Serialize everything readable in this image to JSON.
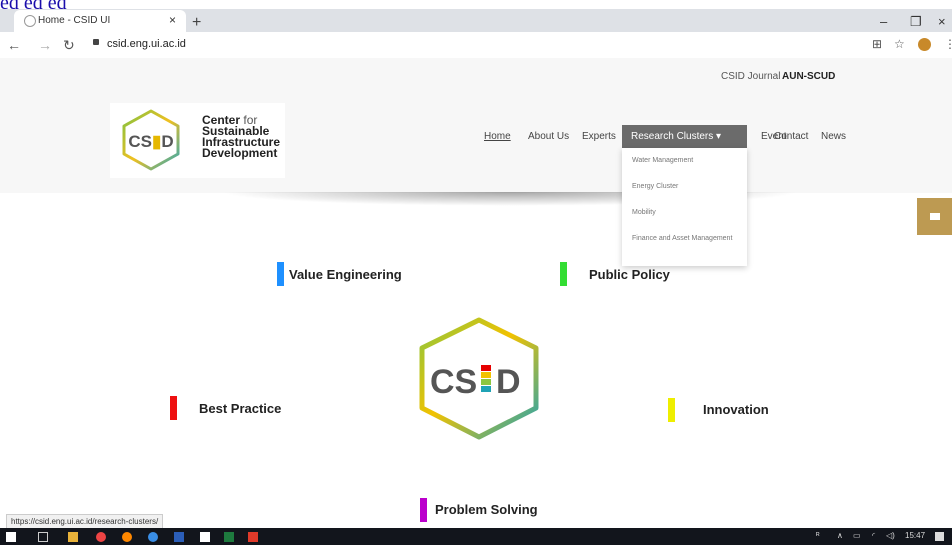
{
  "top_link": "ed  ed  ed",
  "browser": {
    "tab_title": "Home - CSID UI",
    "tab_close": "×",
    "new_tab": "+",
    "window_min": "–",
    "window_max": "❐",
    "window_close": "×",
    "url": "csid.eng.ui.ac.id"
  },
  "site": {
    "top_links": [
      "CSID Journal",
      "AUN-SCUD"
    ],
    "logo": {
      "abbr": "CS D",
      "line1": "Center",
      "line1_for": "for",
      "line2": "Sustainable",
      "line3": "Infrastructure",
      "line4": "Development"
    },
    "nav": {
      "home": "Home",
      "about": "About Us",
      "experts": "Experts",
      "research": "Research Clusters ▾",
      "event": "Event",
      "contact": "Contact",
      "news": "News"
    },
    "dropdown": [
      "Water Management",
      "Energy Cluster",
      "Mobility",
      "Finance and Asset Management"
    ],
    "clusters": [
      {
        "label": "Value Engineering",
        "color": "#1e90ff"
      },
      {
        "label": "Public Policy",
        "color": "#33dd33"
      },
      {
        "label": "Best Practice",
        "color": "#ee1111"
      },
      {
        "label": "Innovation",
        "color": "#eeee00"
      },
      {
        "label": "Problem Solving",
        "color": "#bb00cc"
      }
    ],
    "center_logo_text": "CS D"
  },
  "status_url": "https://csid.eng.ui.ac.id/research-clusters/",
  "tray": {
    "time": "15:47"
  },
  "colors": {
    "accent_gold": "#bd9a52",
    "nav_active_bg": "#6b6b6b"
  }
}
